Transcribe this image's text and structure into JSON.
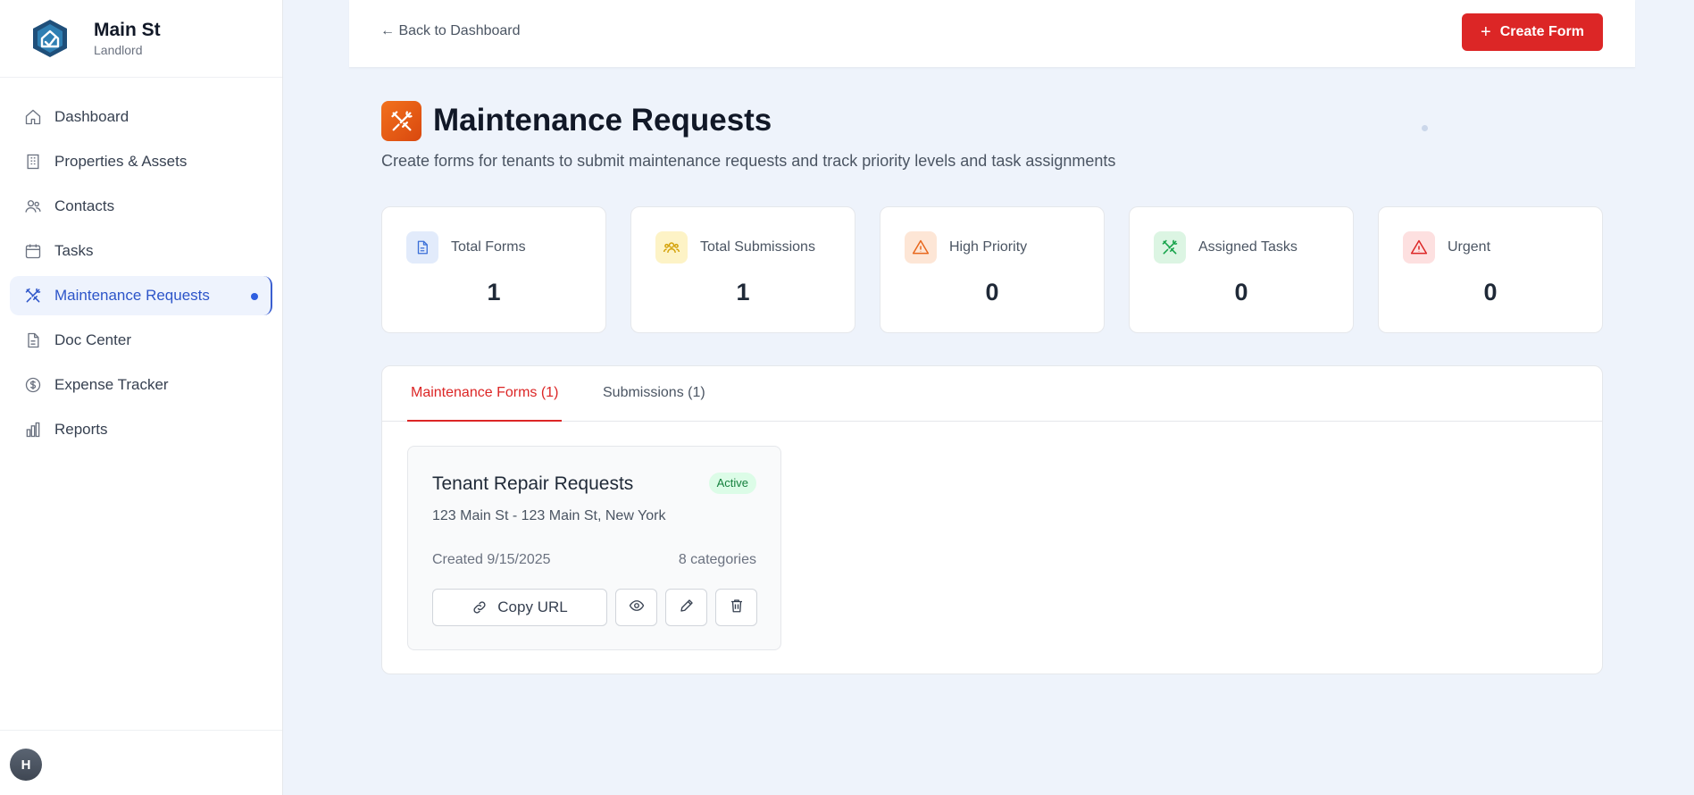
{
  "sidebar": {
    "brand_name": "Main St",
    "brand_role": "Landlord",
    "items": [
      {
        "label": "Dashboard",
        "icon": "home-icon"
      },
      {
        "label": "Properties & Assets",
        "icon": "building-icon"
      },
      {
        "label": "Contacts",
        "icon": "users-icon"
      },
      {
        "label": "Tasks",
        "icon": "calendar-icon"
      },
      {
        "label": "Maintenance Requests",
        "icon": "tools-icon",
        "active": true
      },
      {
        "label": "Doc Center",
        "icon": "document-icon"
      },
      {
        "label": "Expense Tracker",
        "icon": "dollar-icon"
      },
      {
        "label": "Reports",
        "icon": "bar-chart-icon"
      }
    ],
    "avatar_initial": "H"
  },
  "topbar": {
    "back_label": "← Back to Dashboard",
    "create_label": "Create Form",
    "create_plus": "+"
  },
  "header": {
    "title": "Maintenance Requests",
    "subtitle": "Create forms for tenants to submit maintenance requests and track priority levels and task assignments"
  },
  "stats": [
    {
      "label": "Total Forms",
      "value": "1",
      "icon": "file-icon",
      "color": "#3b6fd8",
      "bg": "#e2ebfb"
    },
    {
      "label": "Total Submissions",
      "value": "1",
      "icon": "group-icon",
      "color": "#d4a20a",
      "bg": "#fdf3c6"
    },
    {
      "label": "High Priority",
      "value": "0",
      "icon": "warning-icon",
      "color": "#e8671c",
      "bg": "#fde6d6"
    },
    {
      "label": "Assigned Tasks",
      "value": "0",
      "icon": "tools-icon",
      "color": "#16a34a",
      "bg": "#dcf5e3"
    },
    {
      "label": "Urgent",
      "value": "0",
      "icon": "alert-icon",
      "color": "#dc2626",
      "bg": "#fde0e0"
    }
  ],
  "tabs": [
    {
      "label": "Maintenance Forms (1)",
      "active": true
    },
    {
      "label": "Submissions (1)",
      "active": false
    }
  ],
  "form_card": {
    "title": "Tenant Repair Requests",
    "status": "Active",
    "address": "123 Main St - 123 Main St, New York",
    "created": "Created 9/15/2025",
    "categories": "8 categories",
    "copy_label": "Copy URL"
  },
  "colors": {
    "accent_red": "#dc2626",
    "active_nav": "#2d55c9",
    "page_bg": "#eef3fb"
  }
}
